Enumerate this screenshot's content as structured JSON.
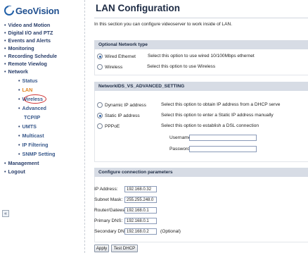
{
  "brand": {
    "name": "GeoVision"
  },
  "sidebar": {
    "items": [
      {
        "label": "Video and Motion"
      },
      {
        "label": "Digital I/O and PTZ"
      },
      {
        "label": "Events and Alerts"
      },
      {
        "label": "Monitoring"
      },
      {
        "label": "Recording Schedule"
      },
      {
        "label": "Remote Viewlog"
      },
      {
        "label": "Network"
      }
    ],
    "network_subitems": [
      {
        "label": "Status"
      },
      {
        "label": "LAN"
      },
      {
        "label": "Wireless"
      },
      {
        "label": "Advanced"
      },
      {
        "label": "TCP/IP"
      },
      {
        "label": "UMTS"
      },
      {
        "label": "Multicast"
      },
      {
        "label": "IP Filtering"
      },
      {
        "label": "SNMP Setting"
      }
    ],
    "bottom_items": [
      {
        "label": "Management"
      },
      {
        "label": "Logout"
      }
    ],
    "collapse_glyph": "«",
    "active_item": "LAN",
    "highlight_color": "#d03030"
  },
  "main": {
    "title": "LAN Configuration",
    "intro": "In this section you can configure videoserver to work inside of LAN.",
    "network_type": {
      "header": "Optional Network type",
      "options": [
        {
          "label": "Wired Ethernet",
          "desc": "Select this option to use wired 10/100Mbps ethernet",
          "checked": true
        },
        {
          "label": "Wireless",
          "desc": "Select this option to use Wireless",
          "checked": false
        }
      ]
    },
    "ip_mode": {
      "header": "NetworkIDS_VS_ADVANCED_SETTING",
      "options": [
        {
          "label": "Dynamic IP address",
          "desc": "Select this option to obtain IP address from a DHCP serve",
          "checked": false
        },
        {
          "label": "Static IP address",
          "desc": "Select this option to enter a Static IP address manually",
          "checked": true
        },
        {
          "label": "PPPoE",
          "desc": "Select this option to establish a DSL connection",
          "checked": false
        }
      ],
      "username_label": "Username:",
      "username_value": "",
      "password_label": "Password:",
      "password_value": ""
    },
    "connection": {
      "header": "Configure connection parameters",
      "fields": [
        {
          "label": "IP Address:",
          "value": "192.168.0.32"
        },
        {
          "label": "Subnet Mask:",
          "value": "255.255.248.0"
        },
        {
          "label": "Router/Gateway:",
          "value": "192.168.0.1"
        },
        {
          "label": "Primary DNS:",
          "value": "192.168.0.1"
        },
        {
          "label": "Secondary DNS:",
          "value": "192.168.0.2"
        }
      ],
      "optional_note": "(Optional)"
    },
    "buttons": {
      "apply": "Apply",
      "test_dhcp": "Test DHCP"
    }
  }
}
